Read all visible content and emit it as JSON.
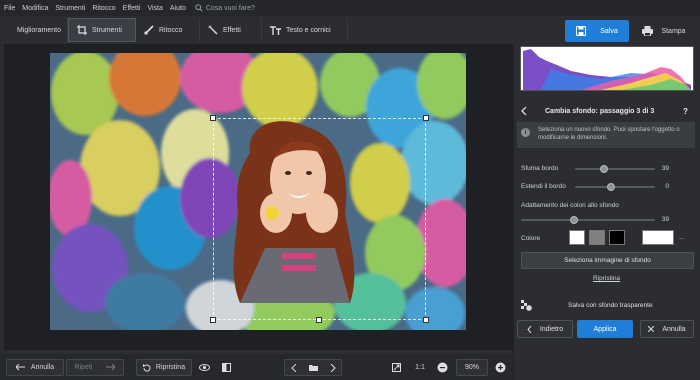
{
  "menu": [
    "File",
    "Modifica",
    "Strumenti",
    "Ritocco",
    "Effetti",
    "Vista",
    "Aiuto"
  ],
  "search": {
    "placeholder": "Cosa vuoi fare?"
  },
  "tabs": [
    {
      "label": "Miglioramento",
      "icon": "sliders-icon"
    },
    {
      "label": "Strumenti",
      "icon": "crop-icon"
    },
    {
      "label": "Ritocco",
      "icon": "brush-icon"
    },
    {
      "label": "Effetti",
      "icon": "magic-wand-icon"
    },
    {
      "label": "Testo e cornici",
      "icon": "text-icon"
    }
  ],
  "header": {
    "save_label": "Salva",
    "print_label": "Stampa"
  },
  "bottom": {
    "undo_label": "Annulla",
    "redo_label": "Ripeti",
    "restore_label": "Ripristina",
    "zoom_ratio": "1:1",
    "zoom_value": "90%"
  },
  "panel": {
    "step_title": "Cambia sfondo: passaggio 3 di 3",
    "help": "?",
    "info_text": "Seleziona un nuovo sfondo. Puoi spostare l'oggetto o modificarne le dimensioni.",
    "blur_label": "Sfuma bordo",
    "blur_value": "39",
    "blur_level": 0.39,
    "extend_label": "Estendi il bordo",
    "extend_value": "0",
    "extend_level": 0.5,
    "adapt_label": "Adattamento dei colori allo sfondo",
    "adapt_value": "39",
    "adapt_level": 0.39,
    "color_label": "Colore",
    "more": "...",
    "select_bg_label": "Seleziona immagine di sfondo",
    "restore_link": "Ripristina",
    "transparent_label": "Salva con sfondo trasparente",
    "back_label": "Indietro",
    "apply_label": "Applica",
    "cancel_label": "Annulla"
  },
  "colors": {
    "accent": "#1f7fd8",
    "swatches": [
      "#ffffff",
      "#808080",
      "#000000",
      "#ffffff"
    ]
  }
}
